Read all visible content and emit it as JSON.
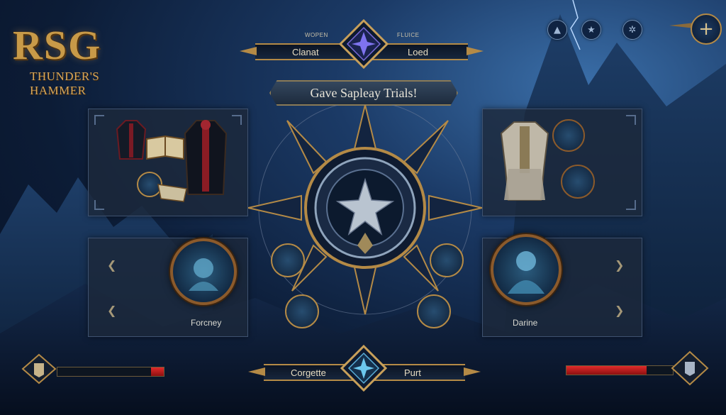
{
  "logo": {
    "main": "RSG",
    "sub": "THUNDER'S HAMMER"
  },
  "top_icons": [
    "triangle-icon",
    "star-icon",
    "gear-icon"
  ],
  "plus_label": "+",
  "top_banner": {
    "small_left": "WOPEN",
    "small_right": "FLUICE",
    "left": "Clanat",
    "right": "Loed"
  },
  "title": "Gave Sapleay Trials!",
  "left_character": {
    "name": "Forcney"
  },
  "right_character": {
    "name": "Darine"
  },
  "bottom_banner": {
    "left": "Corgette",
    "right": "Purt"
  },
  "health": {
    "left_fraction": 0.12,
    "right_fraction": 0.75
  },
  "colors": {
    "gold": "#b48a46",
    "panel": "#1c283a",
    "accent_blue": "#3f8fc2",
    "health_red": "#e02a2a"
  }
}
